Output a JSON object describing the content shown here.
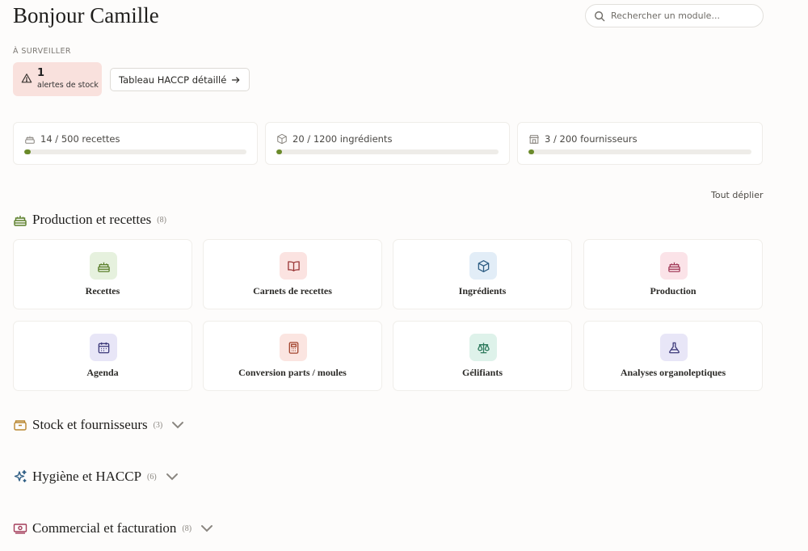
{
  "header": {
    "title": "Bonjour Camille",
    "search_placeholder": "Rechercher un module..."
  },
  "watch": {
    "label": "À SURVEILLER",
    "alert_count": "1",
    "alert_label": "alertes de stock",
    "haccp_button": "Tableau HACCP détaillé"
  },
  "stats": [
    {
      "label": "14 / 500 recettes",
      "icon": "cake-icon",
      "progress": 0.028
    },
    {
      "label": "20 / 1200 ingrédients",
      "icon": "box-icon",
      "progress": 0.017
    },
    {
      "label": "3 / 200 fournisseurs",
      "icon": "store-icon",
      "progress": 0.015
    }
  ],
  "expand_all": "Tout déplier",
  "sections": {
    "production": {
      "title": "Production et recettes",
      "count": "(8)",
      "icon": "cake-icon",
      "tiles": [
        {
          "label": "Recettes",
          "icon": "cake-icon",
          "bg": "#e6f1de",
          "fg": "#5b7f2b"
        },
        {
          "label": "Carnets de recettes",
          "icon": "book-icon",
          "bg": "#fbe3e1",
          "fg": "#9a3838"
        },
        {
          "label": "Ingrédients",
          "icon": "cube-icon",
          "bg": "#e2edf7",
          "fg": "#2f5e84"
        },
        {
          "label": "Production",
          "icon": "cake-icon",
          "bg": "#fbe3e8",
          "fg": "#a33c5a"
        },
        {
          "label": "Agenda",
          "icon": "calendar-icon",
          "bg": "#e8e6f7",
          "fg": "#3d3a7a"
        },
        {
          "label": "Conversion parts / moules",
          "icon": "calculator-icon",
          "bg": "#fbe5e1",
          "fg": "#a3452f"
        },
        {
          "label": "Gélifiants",
          "icon": "scale-icon",
          "bg": "#def2ea",
          "fg": "#2d7a5c"
        },
        {
          "label": "Analyses organoleptiques",
          "icon": "flask-icon",
          "bg": "#e8e6f7",
          "fg": "#3d3a7a"
        }
      ]
    },
    "stock": {
      "title": "Stock et fournisseurs",
      "count": "(3)",
      "icon": "archive-icon"
    },
    "hygiene": {
      "title": "Hygiène et HACCP",
      "count": "(6)",
      "icon": "sparkles-icon"
    },
    "commercial": {
      "title": "Commercial et facturation",
      "count": "(8)",
      "icon": "banknote-icon"
    }
  },
  "colors": {
    "accent": "#6a8a2a",
    "alert_bg": "#f9e1dd"
  }
}
